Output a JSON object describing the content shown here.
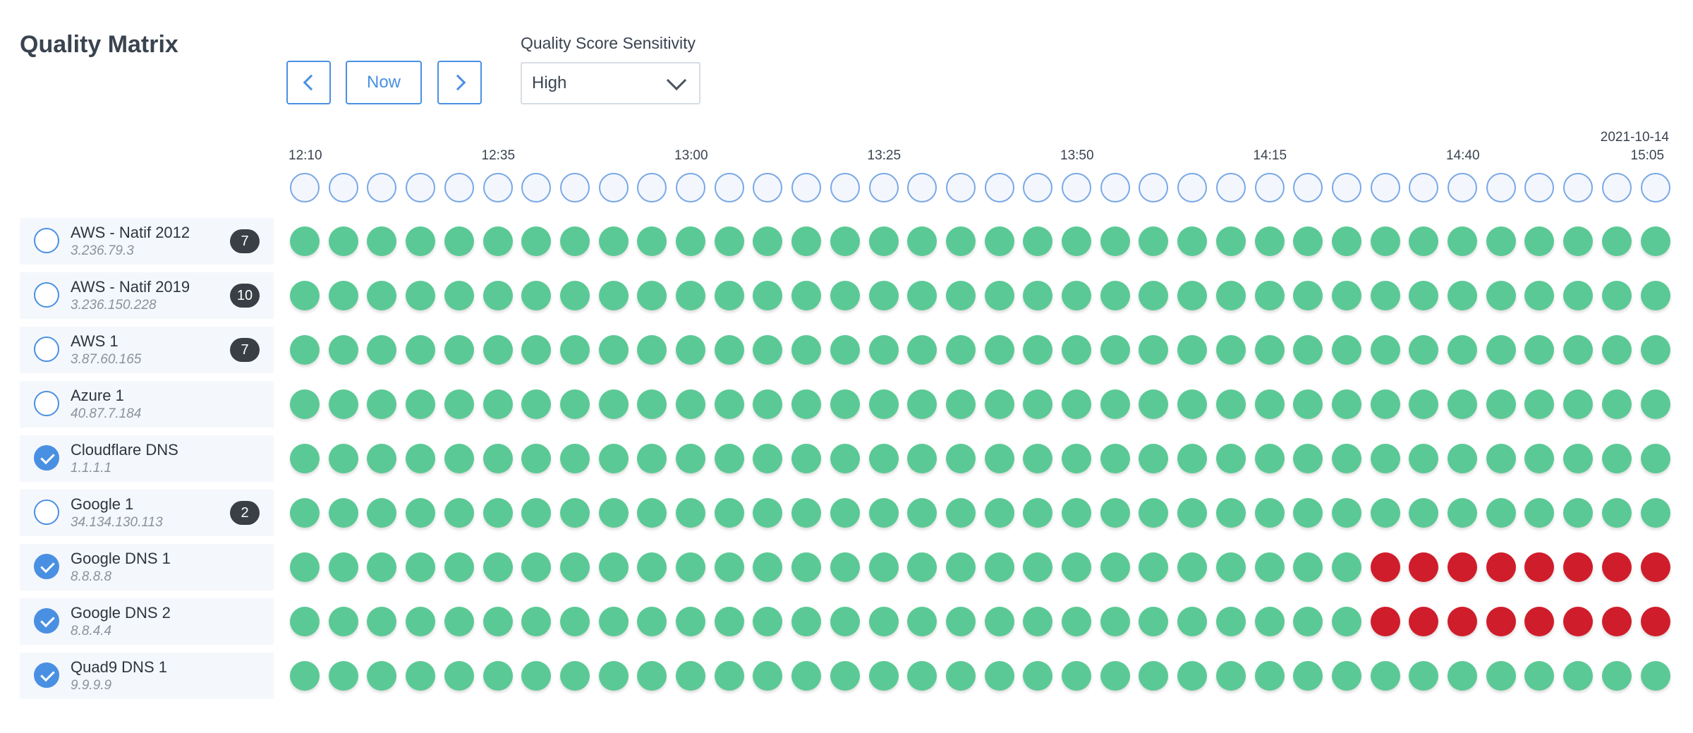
{
  "app": {
    "title": "Quality Matrix"
  },
  "toolbar": {
    "prev_icon": "chevron-left-icon",
    "now_label": "Now",
    "next_icon": "chevron-right-icon"
  },
  "sensitivity": {
    "label": "Quality Score Sensitivity",
    "value": "High",
    "icon": "chevron-down-icon"
  },
  "timeline": {
    "date": "2021-10-14",
    "columns": 36,
    "tick_labels": [
      {
        "column": 0,
        "label": "12:10"
      },
      {
        "column": 5,
        "label": "12:35"
      },
      {
        "column": 10,
        "label": "13:00"
      },
      {
        "column": 15,
        "label": "13:25"
      },
      {
        "column": 20,
        "label": "13:50"
      },
      {
        "column": 25,
        "label": "14:15"
      },
      {
        "column": 30,
        "label": "14:40"
      },
      {
        "column": 35,
        "label": "15:05"
      }
    ]
  },
  "colors": {
    "good": "#5bc995",
    "bad": "#d01d2b",
    "accent": "#4a90e2"
  },
  "agents": [
    {
      "name": "AWS - Natif 2012",
      "ip": "3.236.79.3",
      "checked": false,
      "badge": "7",
      "bad_from": null
    },
    {
      "name": "AWS - Natif 2019",
      "ip": "3.236.150.228",
      "checked": false,
      "badge": "10",
      "bad_from": null
    },
    {
      "name": "AWS 1",
      "ip": "3.87.60.165",
      "checked": false,
      "badge": "7",
      "bad_from": null
    },
    {
      "name": "Azure 1",
      "ip": "40.87.7.184",
      "checked": false,
      "badge": "",
      "bad_from": null
    },
    {
      "name": "Cloudflare DNS",
      "ip": "1.1.1.1",
      "checked": true,
      "badge": "",
      "bad_from": null
    },
    {
      "name": "Google 1",
      "ip": "34.134.130.113",
      "checked": false,
      "badge": "2",
      "bad_from": null
    },
    {
      "name": "Google DNS 1",
      "ip": "8.8.8.8",
      "checked": true,
      "badge": "",
      "bad_from": 28
    },
    {
      "name": "Google DNS 2",
      "ip": "8.8.4.4",
      "checked": true,
      "badge": "",
      "bad_from": 28
    },
    {
      "name": "Quad9 DNS 1",
      "ip": "9.9.9.9",
      "checked": true,
      "badge": "",
      "bad_from": null
    }
  ]
}
